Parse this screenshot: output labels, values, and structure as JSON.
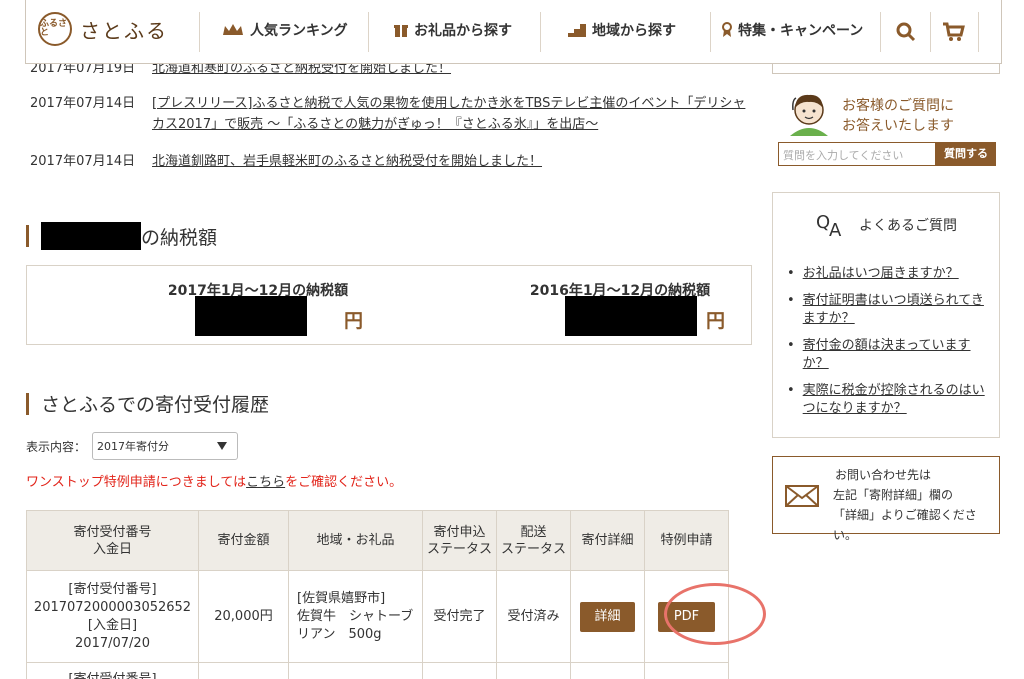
{
  "header": {
    "logo_mark": "ふるさと",
    "logo_text": "さとふる",
    "nav": [
      {
        "label": "人気ランキング",
        "icon": "crown-icon"
      },
      {
        "label": "お礼品から探す",
        "icon": "gift-icon"
      },
      {
        "label": "地域から探す",
        "icon": "region-icon"
      },
      {
        "label": "特集・キャンペーン",
        "icon": "ribbon-icon"
      }
    ]
  },
  "news": [
    {
      "date": "2017年07月19日",
      "title": "北海道和寒町のふるさと納税受付を開始しました！"
    },
    {
      "date": "2017年07月14日",
      "title": "[プレスリリース]ふるさと納税で人気の果物を使用したかき氷をTBSテレビ主催のイベント「デリシャカス2017」で販売 ～「ふるさとの魅力がぎゅっ！『さとふる氷』」を出店～"
    },
    {
      "date": "2017年07月14日",
      "title": "北海道釧路町、岩手県軽米町のふるさと納税受付を開始しました！"
    }
  ],
  "tax": {
    "heading_suffix": "の納税額",
    "col1_label": "2017年1月～12月の納税額",
    "col2_label": "2016年1月～12月の納税額",
    "yen": "円"
  },
  "history": {
    "heading": "さとふるでの寄付受付履歴",
    "display_label": "表示内容：",
    "display_value": "2017年寄付分",
    "onestop_pre": "ワンストップ特例申請につきましては",
    "onestop_link": "こちら",
    "onestop_post": "をご確認ください。",
    "columns": [
      "寄付受付番号\n入金日",
      "寄付金額",
      "地域・お礼品",
      "寄付申込\nステータス",
      "配送\nステータス",
      "寄付詳細",
      "特例申請"
    ],
    "rows": [
      {
        "id_label": "[寄付受付番号]",
        "id": "2017072000003052652",
        "date_label": "[入金日]",
        "date": "2017/07/20",
        "amount": "20,000円",
        "region": "[佐賀県嬉野市]",
        "item": "佐賀牛　シャトーブリアン　500g",
        "apply_status": "受付完了",
        "ship_status": "受付済み",
        "detail_btn": "詳細",
        "pdf_btn": "PDF"
      }
    ],
    "next_row_label": "[寄付受付番号]"
  },
  "sidebar": {
    "ask_line1": "お客様のご質問に",
    "ask_line2": "お答えいたします",
    "ask_placeholder": "質問を入力してください",
    "ask_button": "質問する",
    "faq_title": "よくあるご質問",
    "faq_items": [
      "お礼品はいつ届きますか？",
      "寄付証明書はいつ頃送られてきますか？",
      "寄付金の額は決まっていますか？",
      "実際に税金が控除されるのはいつになりますか？"
    ],
    "contact_l1": "お問い合わせ先は",
    "contact_l2": "左記「寄附詳細」欄の",
    "contact_l3": "「詳細」よりご確認ください。"
  },
  "colors": {
    "brand": "#8a5a2b",
    "alert": "#e2241a",
    "highlight_circle": "#e8736a"
  }
}
